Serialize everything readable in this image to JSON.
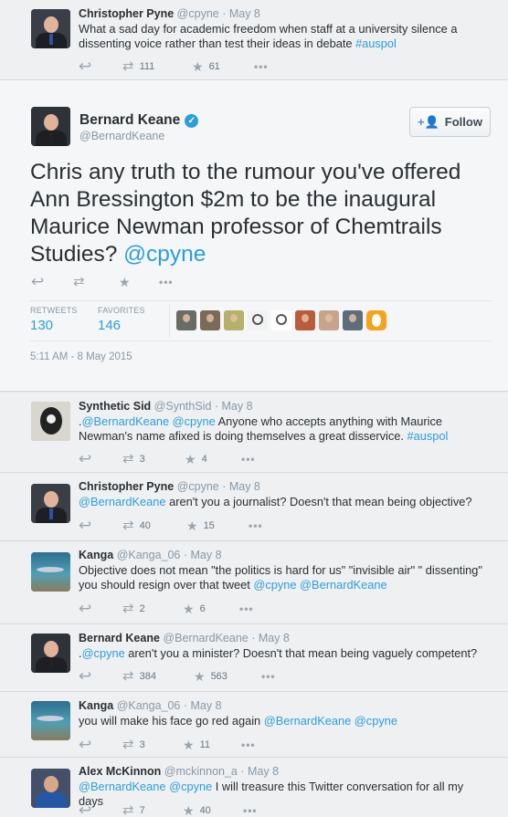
{
  "top_tweet": {
    "name": "Christopher Pyne",
    "meta": "@cpyne · May 8",
    "text": "What a sad day for academic freedom when staff at a university silence a dissenting voice rather than test their ideas in debate",
    "hashtag": "#auspol",
    "retweets": "111",
    "favorites": "61"
  },
  "main_tweet": {
    "name": "Bernard Keane",
    "handle": "@BernardKeane",
    "follow_label": "Follow",
    "text": "Chris any truth to the rumour you've offered Ann Bressington $2m to be the inaugural Maurice Newman professor of Chemtrails Studies?",
    "mention": "@cpyne",
    "retweets_label": "RETWEETS",
    "retweets_value": "130",
    "favorites_label": "FAVORITES",
    "favorites_value": "146",
    "timestamp": "5:11 AM - 8 May 2015",
    "favoriter_avatar_colors": [
      "#6b6b66",
      "#7a6a58",
      "#b5b06a",
      "#f2f2f2",
      "#ffffff",
      "#b85c3c",
      "#c9a38c",
      "#5e6d7c",
      "#f7a21b"
    ]
  },
  "replies": [
    {
      "name": "Synthetic Sid",
      "meta": "@SynthSid · May 8",
      "prefix": ".",
      "mentions": "@BernardKeane @cpyne",
      "text": " Anyone who accepts anything with Maurice Newman's name afixed is doing themselves a great disservice.",
      "hashtag": "#auspol",
      "retweets": "3",
      "favorites": "4"
    },
    {
      "name": "Christopher Pyne",
      "meta": "@cpyne · May 8",
      "mentions": "@BernardKeane",
      "text": " aren't you a journalist? Doesn't that mean being objective?",
      "retweets": "40",
      "favorites": "15"
    },
    {
      "name": "Kanga",
      "meta": "@Kanga_06 · May 8",
      "text": "Objective does not mean \"the politics is hard for us\" \"invisible air\" \" dissenting\" you should resign over that tweet ",
      "mentions": "@cpyne @BernardKeane",
      "retweets": "2",
      "favorites": "6"
    },
    {
      "name": "Bernard Keane",
      "meta": "@BernardKeane · May 8",
      "prefix": ".",
      "mentions": "@cpyne",
      "text": " aren't you a minister? Doesn't that mean being vaguely competent?",
      "retweets": "384",
      "favorites": "563"
    },
    {
      "name": "Kanga",
      "meta": "@Kanga_06 · May 8",
      "text": "you will make his face go red again ",
      "mentions": "@BernardKeane @cpyne",
      "retweets": "3",
      "favorites": "11"
    },
    {
      "name": "Alex McKinnon",
      "meta": "@mckinnon_a · May 8",
      "mentions": "@BernardKeane @cpyne",
      "text": " I will treasure this Twitter conversation for all my days",
      "retweets": "7",
      "favorites": "40"
    }
  ],
  "icons": {
    "reply": "reply-icon",
    "retweet": "retweet-icon",
    "favorite": "star-icon",
    "more": "more-icon"
  }
}
